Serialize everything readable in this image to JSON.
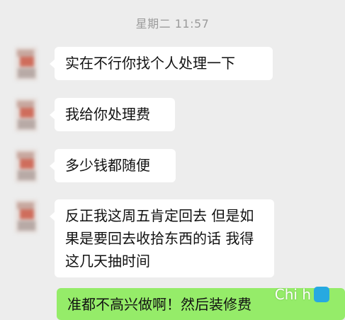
{
  "chat": {
    "timestamp": "星期二 11:57",
    "messages": [
      {
        "lines": [
          "实在不行你找个人处理一下"
        ]
      },
      {
        "lines": [
          "我给你处理费"
        ]
      },
      {
        "lines": [
          "多少钱都随便"
        ]
      },
      {
        "lines": [
          "反正我这周五肯定回去 但是如",
          "果是要回去收拾东西的话 我得",
          "这几天抽时间"
        ]
      }
    ],
    "outgoing_partial": "准都不高兴做啊！然后装修费"
  },
  "watermark": {
    "text": "Chi  h"
  }
}
